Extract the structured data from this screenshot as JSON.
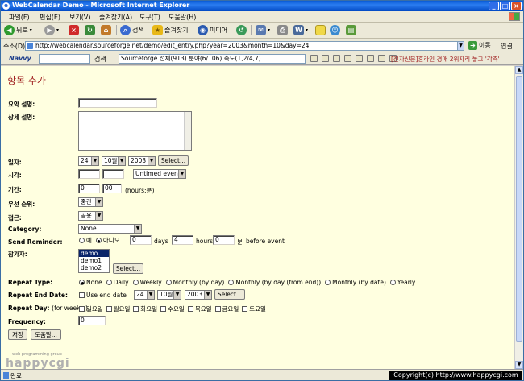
{
  "window": {
    "title": "WebCalendar Demo - Microsoft Internet Explorer"
  },
  "menu": [
    "파일(F)",
    "편집(E)",
    "보기(V)",
    "즐겨찾기(A)",
    "도구(T)",
    "도움말(H)"
  ],
  "toolbar": {
    "back": "뒤로",
    "search": "검색",
    "favorites": "즐겨찾기",
    "media": "미디어"
  },
  "address": {
    "label": "주소(D)",
    "url": "http://webcalendar.sourceforge.net/demo/edit_entry.php?year=2003&month=10&day=24",
    "go": "이동",
    "links": "연결"
  },
  "navvy": {
    "brand": "Navvy",
    "search_btn": "검색",
    "ticker": "Sourceforge    전체(913)    분야(6/106)    속도(1,2/4,7)",
    "news": "[전자신문]혼라인 경매 2위자리 놓고 '각축'"
  },
  "page": {
    "title": "항목 추가",
    "labels": {
      "brief": "요약 설명:",
      "full": "상세 설명:",
      "date": "일자:",
      "time": "시각:",
      "duration": "기간:",
      "priority": "우선 순위:",
      "access": "접근:",
      "category": "Category:",
      "reminder": "Send Reminder:",
      "participants": "참가자:",
      "repeat_type": "Repeat Type:",
      "repeat_end": "Repeat End Date:",
      "repeat_day": "Repeat Day:",
      "repeat_day_sub": "(for weekly)",
      "frequency": "Frequency:"
    },
    "date": {
      "day": "24",
      "month": "10월",
      "year": "2003",
      "select": "Select..."
    },
    "time": {
      "event_type": "Untimed event"
    },
    "duration": {
      "hours": "0",
      "minutes": "00",
      "unit": "(hours:분)"
    },
    "priority": "중간",
    "access": "공용",
    "category": "None",
    "reminder": {
      "yes": "예",
      "no": "아니오",
      "days_val": "0",
      "days": "days",
      "hours_val": "4",
      "hours": "hours",
      "min_val": "0",
      "min": "분",
      "before": "before event"
    },
    "participants": {
      "items": [
        "demo",
        "demo1",
        "demo2"
      ],
      "select": "Select..."
    },
    "repeat_types": [
      "None",
      "Daily",
      "Weekly",
      "Monthly (by day)",
      "Monthly (by day (from end))",
      "Monthly (by date)",
      "Yearly"
    ],
    "repeat_end": {
      "use": "Use end date",
      "day": "24",
      "month": "10월",
      "year": "2003",
      "select": "Select..."
    },
    "repeat_days": [
      "일요일",
      "월요일",
      "화요일",
      "수요일",
      "목요일",
      "금요일",
      "토요일"
    ],
    "frequency": "0",
    "buttons": {
      "save": "저장",
      "help": "도움말..."
    },
    "logo": {
      "small": "web programming group",
      "big": "happycgi"
    }
  },
  "status": {
    "text": "완료"
  },
  "copyright": "Copyright(c) http://www.happycgi.com"
}
